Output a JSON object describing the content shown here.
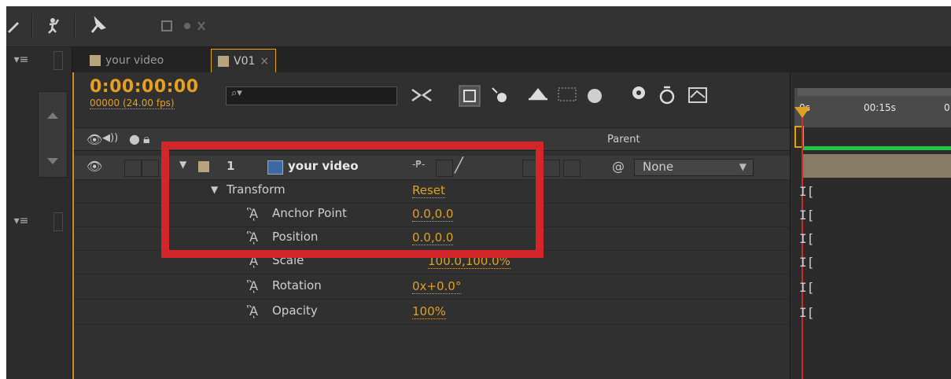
{
  "tabs": [
    {
      "label": "your video"
    },
    {
      "label": "V01",
      "close": "×"
    }
  ],
  "timecode": "0:00:00:00",
  "frames": "00000 (24.00 fps)",
  "search_placeholder": "",
  "header": {
    "parent": "Parent"
  },
  "ruler": {
    "t0": "0s",
    "t1": "00:15s",
    "t2": "0"
  },
  "layer": {
    "number": "1",
    "name": "your video",
    "parent": "None"
  },
  "transform": {
    "label": "Transform",
    "reset": "Reset"
  },
  "properties": [
    {
      "name": "Anchor Point",
      "value": "0.0,0.0"
    },
    {
      "name": "Position",
      "value": "0.0,0.0"
    },
    {
      "name": "Scale",
      "value": "100.0,100.0%"
    },
    {
      "name": "Rotation",
      "value": "0x+0.0°"
    },
    {
      "name": "Opacity",
      "value": "100%"
    }
  ],
  "icons": [
    "pen-icon",
    "puppet-icon",
    "pin-icon",
    "puppet-overlap-icon",
    "hamburger-icon",
    "stopwatch-icon",
    "eye-icon",
    "audio-icon",
    "lock-icon"
  ],
  "colors": {
    "accent": "#e6a01e",
    "highlight": "#d2262a",
    "bar_green": "#23c24a"
  }
}
